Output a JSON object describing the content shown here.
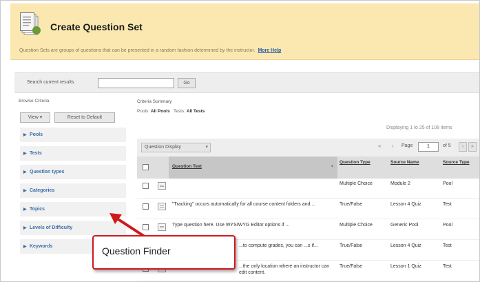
{
  "header": {
    "title": "Create Question Set",
    "description": "Question Sets are groups of questions that can be presented in a random fashion determined by the instructor.",
    "more_help": "More Help"
  },
  "search": {
    "label": "Search current results",
    "value": "",
    "go_label": "Go"
  },
  "browse": {
    "title": "Browse Criteria",
    "view_label": "View ▾",
    "reset_label": "Reset to Default",
    "criteria": [
      {
        "label": "Pools"
      },
      {
        "label": "Tests"
      },
      {
        "label": "Question types"
      },
      {
        "label": "Categories"
      },
      {
        "label": "Topics"
      },
      {
        "label": "Levels of Difficulty"
      },
      {
        "label": "Keywords"
      }
    ]
  },
  "summary": {
    "title": "Criteria Summary",
    "pools_label": "Pools:",
    "pools_value": "All Pools",
    "tests_label": "Tests:",
    "tests_value": "All Tests",
    "displaying": "Displaying 1 to 25 of 108 items"
  },
  "toolbar": {
    "display_label": "Question Display",
    "first_label": "«",
    "prev_label": "‹",
    "page_label": "Page",
    "page_value": "1",
    "page_of": "of 5",
    "next_label": "›",
    "last_label": "»"
  },
  "table": {
    "headers": {
      "question_text": "Question Text",
      "question_type": "Question Type",
      "source_name": "Source Name",
      "source_type": "Source Type"
    },
    "rows": [
      {
        "text": "",
        "type": "Multiple Choice",
        "source": "Module 2",
        "source_type": "Pool"
      },
      {
        "text": "\"Tracking\" occurs automatically for all course content folders and ...",
        "type": "True/False",
        "source": "Lesson 4 Quiz",
        "source_type": "Test"
      },
      {
        "text": "Type question here.  Use WYSIWYG Editor options if ...",
        "type": "Multiple Choice",
        "source": "Generic Pool",
        "source_type": "Pool"
      },
      {
        "text": "...to compute grades, you can ...s if...",
        "type": "True/False",
        "source": "Lesson 4 Quiz",
        "source_type": "Test"
      },
      {
        "text": "...the only location where an instructor can edit content.",
        "type": "True/False",
        "source": "Lesson 1 Quiz",
        "source_type": "Test"
      }
    ]
  },
  "callout": {
    "text": "Question Finder"
  },
  "colors": {
    "header_bg": "#fbe8b0",
    "link": "#3b6ea8",
    "callout_border": "#d0181c"
  }
}
